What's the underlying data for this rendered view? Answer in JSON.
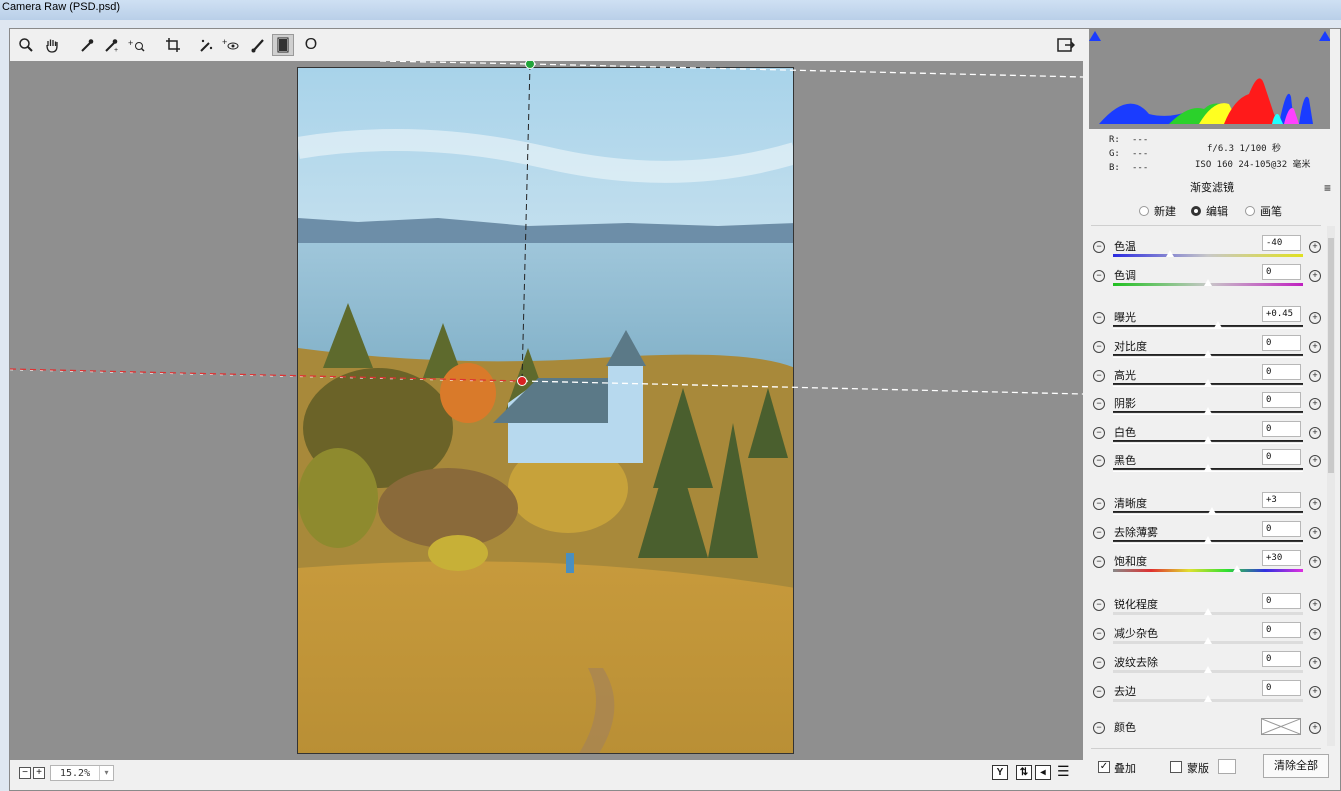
{
  "window": {
    "title": "Camera Raw (PSD.psd)"
  },
  "toolbar": {
    "tools": [
      "zoom-icon",
      "hand-icon",
      "white-balance-icon",
      "color-sampler-icon",
      "target-adjust-icon",
      "crop-icon",
      "spot-removal-icon",
      "red-eye-icon",
      "adjustment-brush-icon",
      "graduated-filter-icon",
      "radial-filter-icon"
    ],
    "radial_label": "O"
  },
  "histogram": {
    "rgb_r": "R:",
    "rgb_g": "G:",
    "rgb_b": "B:",
    "rgb_r_val": "---",
    "rgb_g_val": "---",
    "rgb_b_val": "---",
    "aperture_shutter": "f/6.3  1/100 秒",
    "iso_lens": "ISO 160  24-105@32 毫米"
  },
  "panel": {
    "title": "渐变滤镜",
    "modes": [
      "新建",
      "编辑",
      "画笔"
    ],
    "selected_mode": "编辑"
  },
  "adjustments": [
    {
      "label": "色温",
      "value": "-40",
      "pos": 0.3,
      "track": "temp"
    },
    {
      "label": "色调",
      "value": "0",
      "pos": 0.5,
      "track": "tint"
    },
    {
      "label": "曝光",
      "value": "+0.45",
      "pos": 0.55,
      "track": "gray"
    },
    {
      "label": "对比度",
      "value": "0",
      "pos": 0.5,
      "track": "gray"
    },
    {
      "label": "高光",
      "value": "0",
      "pos": 0.5,
      "track": "gray"
    },
    {
      "label": "阴影",
      "value": "0",
      "pos": 0.5,
      "track": "gray"
    },
    {
      "label": "白色",
      "value": "0",
      "pos": 0.5,
      "track": "gray"
    },
    {
      "label": "黑色",
      "value": "0",
      "pos": 0.5,
      "track": "gray"
    },
    {
      "label": "清晰度",
      "value": "+3",
      "pos": 0.52,
      "track": "gray"
    },
    {
      "label": "去除薄雾",
      "value": "0",
      "pos": 0.5,
      "track": "gray"
    },
    {
      "label": "饱和度",
      "value": "+30",
      "pos": 0.65,
      "track": "sat"
    },
    {
      "label": "锐化程度",
      "value": "0",
      "pos": 0.5,
      "track": "light"
    },
    {
      "label": "减少杂色",
      "value": "0",
      "pos": 0.5,
      "track": "light"
    },
    {
      "label": "波纹去除",
      "value": "0",
      "pos": 0.5,
      "track": "light"
    },
    {
      "label": "去边",
      "value": "0",
      "pos": 0.5,
      "track": "light"
    }
  ],
  "color_row": {
    "label": "颜色"
  },
  "bottom": {
    "overlay_label": "叠加",
    "mask_label": "蒙版",
    "clear_label": "清除全部",
    "overlay_checked": true,
    "mask_checked": false
  },
  "status": {
    "zoom": "15.2%"
  },
  "status_icons": [
    "y-compare-icon",
    "swap-icon",
    "copy-icon",
    "settings-icon"
  ]
}
